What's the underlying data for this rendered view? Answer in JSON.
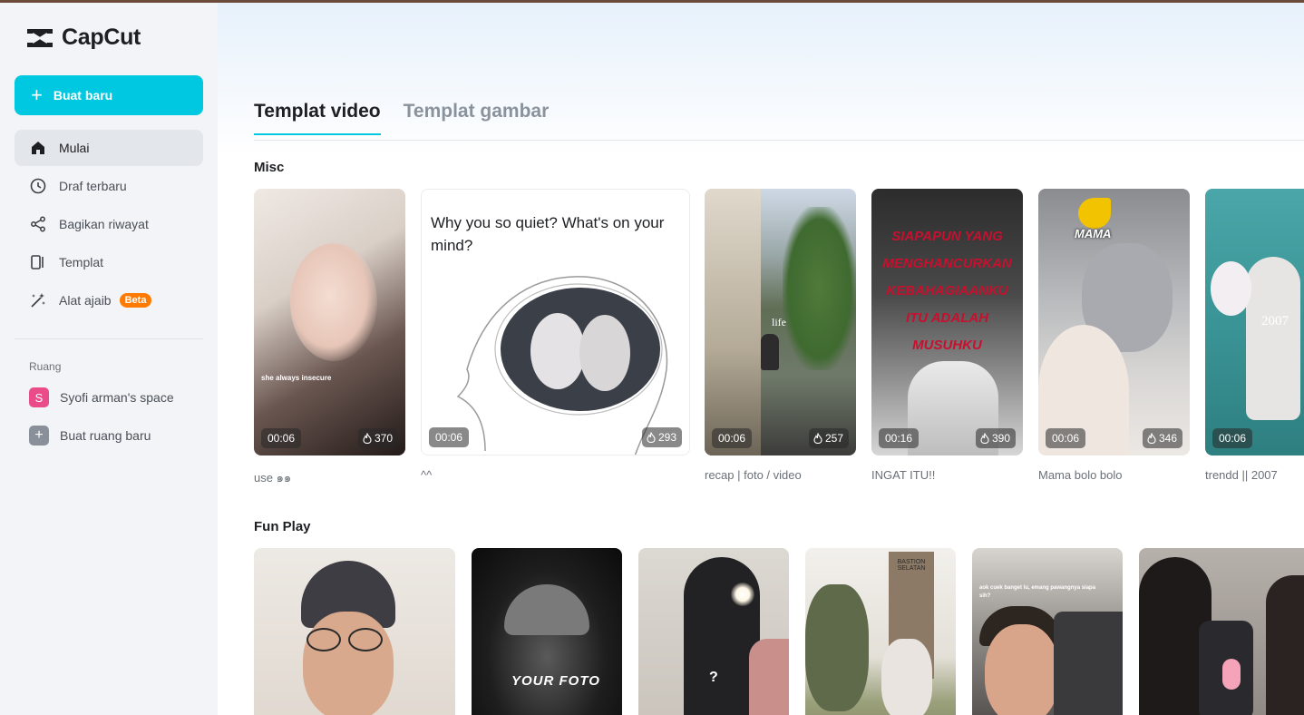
{
  "app": {
    "name": "CapCut"
  },
  "sidebar": {
    "new_button": "Buat baru",
    "nav": [
      {
        "label": "Mulai",
        "icon": "home-icon",
        "active": true
      },
      {
        "label": "Draf terbaru",
        "icon": "clock-icon"
      },
      {
        "label": "Bagikan riwayat",
        "icon": "share-icon"
      },
      {
        "label": "Templat",
        "icon": "template-icon"
      },
      {
        "label": "Alat ajaib",
        "icon": "magic-wand-icon",
        "badge": "Beta"
      }
    ],
    "section_label": "Ruang",
    "spaces": [
      {
        "label": "Syofi arman's space",
        "avatar": "S"
      },
      {
        "label": "Buat ruang baru",
        "avatar": "+"
      }
    ]
  },
  "tabs": [
    {
      "label": "Templat video",
      "active": true
    },
    {
      "label": "Templat gambar"
    }
  ],
  "rows": [
    {
      "title": "Misc",
      "cards": [
        {
          "title": "use ๑๑",
          "duration": "00:06",
          "uses": "370",
          "overlay": "she always insecure"
        },
        {
          "title": "^^",
          "duration": "00:06",
          "uses": "293",
          "overlay": "Why you so quiet? What's on your mind?"
        },
        {
          "title": "recap | foto / video",
          "duration": "00:06",
          "uses": "257",
          "overlay": "life"
        },
        {
          "title": "INGAT ITU!!",
          "duration": "00:16",
          "uses": "390",
          "overlay": "SIAPAPUN YANG MENGHANCURKAN KEBAHAGIAANKU ITU ADALAH MUSUHKU"
        },
        {
          "title": "Mama bolo bolo",
          "duration": "00:06",
          "uses": "346",
          "overlay": "MAMA"
        },
        {
          "title": "trendd || 2007",
          "duration": "00:06",
          "uses": "",
          "overlay": "2007"
        }
      ]
    },
    {
      "title": "Fun Play",
      "cards": [
        {
          "title": "",
          "overlay": ""
        },
        {
          "title": "",
          "overlay": "YOUR FOTO"
        },
        {
          "title": "",
          "overlay": "?"
        },
        {
          "title": "",
          "overlay": "BASTION SELATAN"
        },
        {
          "title": "",
          "overlay": "aok cuek banget lu, emang pawangnya siapa sih?"
        },
        {
          "title": "",
          "overlay": ""
        }
      ]
    }
  ],
  "colors": {
    "accent": "#00c8e0",
    "beta": "#ff7a00",
    "space_avatar": "#ea4c89"
  }
}
